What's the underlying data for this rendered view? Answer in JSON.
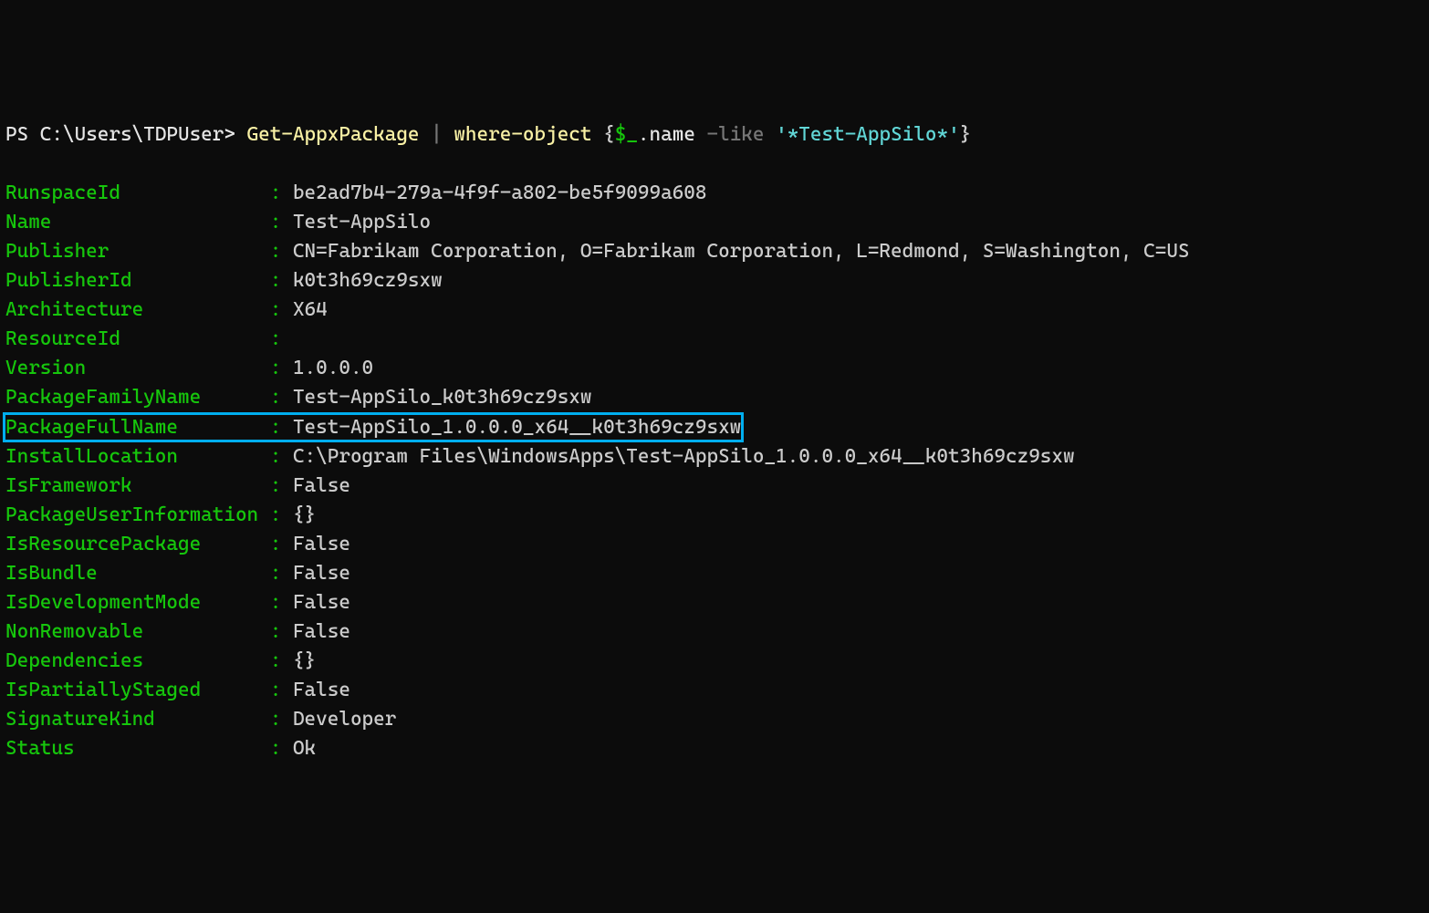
{
  "prompt": {
    "ps": "PS ",
    "path": "C:\\Users\\TDPUser",
    "gt": "> ",
    "cmd1": "Get-AppxPackage",
    "pipe": " | ",
    "cmd2": "where-object ",
    "lbrace": "{",
    "dollar": "$_",
    "dot_name": ".name ",
    "like": "-like ",
    "str": "'*Test-AppSilo*'",
    "rbrace": "}"
  },
  "kv": [
    {
      "k": "RunspaceId            ",
      "c": " : ",
      "v": "be2ad7b4-279a-4f9f-a802-be5f9099a608"
    },
    {
      "k": "Name                  ",
      "c": " : ",
      "v": "Test-AppSilo"
    },
    {
      "k": "Publisher             ",
      "c": " : ",
      "v": "CN=Fabrikam Corporation, O=Fabrikam Corporation, L=Redmond, S=Washington, C=US"
    },
    {
      "k": "PublisherId           ",
      "c": " : ",
      "v": "k0t3h69cz9sxw"
    },
    {
      "k": "Architecture          ",
      "c": " : ",
      "v": "X64"
    },
    {
      "k": "ResourceId            ",
      "c": " : ",
      "v": ""
    },
    {
      "k": "Version               ",
      "c": " : ",
      "v": "1.0.0.0"
    },
    {
      "k": "PackageFamilyName     ",
      "c": " : ",
      "v": "Test-AppSilo_k0t3h69cz9sxw"
    },
    {
      "k": "PackageFullName       ",
      "c": " : ",
      "v": "Test-AppSilo_1.0.0.0_x64__k0t3h69cz9sxw",
      "highlight": true
    },
    {
      "k": "InstallLocation       ",
      "c": " : ",
      "v": "C:\\Program Files\\WindowsApps\\Test-AppSilo_1.0.0.0_x64__k0t3h69cz9sxw"
    },
    {
      "k": "IsFramework           ",
      "c": " : ",
      "v": "False"
    },
    {
      "k": "PackageUserInformation",
      "c": " : ",
      "v": "{}"
    },
    {
      "k": "IsResourcePackage     ",
      "c": " : ",
      "v": "False"
    },
    {
      "k": "IsBundle              ",
      "c": " : ",
      "v": "False"
    },
    {
      "k": "IsDevelopmentMode     ",
      "c": " : ",
      "v": "False"
    },
    {
      "k": "NonRemovable          ",
      "c": " : ",
      "v": "False"
    },
    {
      "k": "Dependencies          ",
      "c": " : ",
      "v": "{}"
    },
    {
      "k": "IsPartiallyStaged     ",
      "c": " : ",
      "v": "False"
    },
    {
      "k": "SignatureKind         ",
      "c": " : ",
      "v": "Developer"
    },
    {
      "k": "Status                ",
      "c": " : ",
      "v": "Ok"
    }
  ]
}
